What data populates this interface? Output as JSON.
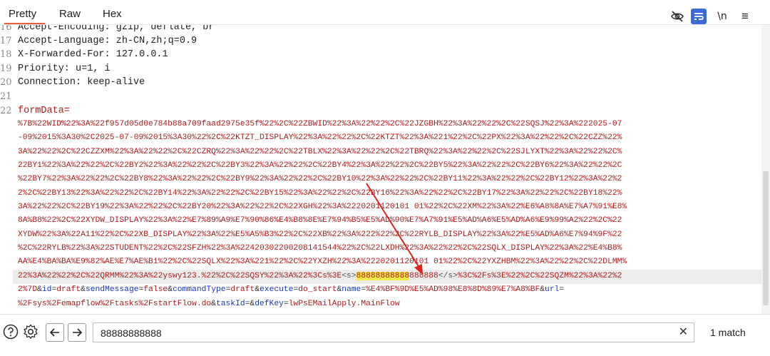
{
  "tabs": [
    "Pretty",
    "Raw",
    "Hex"
  ],
  "toolbar": {
    "newline_label": "\\n",
    "menu_label": "≡"
  },
  "lines": [
    {
      "no": "16",
      "text": "Accept-Encoding: gzip, deflate, br"
    },
    {
      "no": "17",
      "text": "Accept-Language: zh-CN,zh;q=0.9"
    },
    {
      "no": "18",
      "text": "X-Forwarded-For: 127.0.0.1"
    },
    {
      "no": "19",
      "text": "Priority: u=1, i"
    },
    {
      "no": "20",
      "text": "Connection: keep-alive"
    },
    {
      "no": "21",
      "text": ""
    },
    {
      "no": "22",
      "text": "formData="
    }
  ],
  "body_rows": [
    "%7B%22WID%22%3A%22f957d05d0e784b88a709faad2975e35f%22%2C%22ZBWID%22%3A%22%22%2C%22JZGBH%22%3A%22%22%2C%22SQSJ%22%3A%222025-07",
    "-09%2015%3A30%2C2025-07-09%2015%3A30%22%2C%22KTZT_DISPLAY%22%3A%22%22%2C%22KTZT%22%3A%221%22%2C%22PX%22%3A%22%22%2C%22CZZ%22%",
    "3A%22%22%2C%22CZZXM%22%3A%22%22%2C%22CZRQ%22%3A%22%22%2C%22TBLX%22%3A%22%22%2C%22TBRQ%22%3A%22%22%2C%22SJLYXT%22%3A%22%22%2C%",
    "22BY1%22%3A%22%22%2C%22BY2%22%3A%22%22%2C%22BY3%22%3A%22%22%2C%22BY4%22%3A%22%22%2C%22BY5%22%3A%22%22%2C%22BY6%22%3A%22%22%2C",
    "%22BY7%22%3A%22%22%2C%22BY8%22%3A%22%22%2C%22BY9%22%3A%22%22%2C%22BY10%22%3A%22%22%2C%22BY11%22%3A%22%22%2C%22BY12%22%3A%22%2",
    "2%2C%22BY13%22%3A%22%22%2C%22BY14%22%3A%22%22%2C%22BY15%22%3A%22%22%2C%22BY16%22%3A%22%22%2C%22BY17%22%3A%22%22%2C%22BY18%22%",
    "3A%22%22%2C%22BY19%22%3A%22%22%2C%22BY20%22%3A%22%22%2C%22XGH%22%3A%2220201120101 01%22%2C%22XM%22%3A%22%E6%A8%8A%E7%A7%91%E8%",
    "8A%B8%22%2C%22XYDW_DISPLAY%22%3A%22%E7%89%A9%E7%90%86%E4%B8%8E%E7%94%B5%E5%AD%90%E7%A7%91%E5%AD%A6%E5%AD%A6%E9%99%A2%22%2C%22",
    "XYDW%22%3A%22A11%22%2C%22XB_DISPLAY%22%3A%22%E5%A5%B3%22%2C%22XB%22%3A%222%22%2C%22RYLB_DISPLAY%22%3A%22%E5%AD%A6%E7%94%9F%22",
    "%2C%22RYLB%22%3A%22STUDENT%22%2C%22SFZH%22%3A%22420302200208141544%22%2C%22LXDH%22%3A%22%22%2C%22SQLX_DISPLAY%22%3A%22%E4%B8%",
    "AA%E4%BA%BA%E9%82%AE%E7%AE%B1%22%2C%22SQLX%22%3A%221%22%2C%22YXZH%22%3A%2220201120101 01%22%2C%22YXZHBM%22%3A%22%22%2C%22DLMM%"
  ],
  "highlight_row": {
    "before": "22%3A%22%22%2C%22QRMM%22%3A%22yswy123.%22%2C%22SQSY%22%3A%22%3Cs%3E",
    "tag_open": "<s>",
    "match": "88888888888",
    "after_match": "888888",
    "tag_close": "</s>",
    "tail": "%3C%2Fs%3E%22%2C%22SQZM%22%3A%22%2"
  },
  "param_row": [
    {
      "t": "2%7D",
      "c": "v"
    },
    {
      "t": "&",
      "c": "p"
    },
    {
      "t": "id",
      "c": "k"
    },
    {
      "t": "=",
      "c": "p"
    },
    {
      "t": "draft",
      "c": "v"
    },
    {
      "t": "&",
      "c": "p"
    },
    {
      "t": "sendMessage",
      "c": "k"
    },
    {
      "t": "=",
      "c": "p"
    },
    {
      "t": "false",
      "c": "v"
    },
    {
      "t": "&",
      "c": "p"
    },
    {
      "t": "commandType",
      "c": "k"
    },
    {
      "t": "=",
      "c": "p"
    },
    {
      "t": "draft",
      "c": "v"
    },
    {
      "t": "&",
      "c": "p"
    },
    {
      "t": "execute",
      "c": "k"
    },
    {
      "t": "=",
      "c": "p"
    },
    {
      "t": "do_start",
      "c": "v"
    },
    {
      "t": "&",
      "c": "p"
    },
    {
      "t": "name",
      "c": "k"
    },
    {
      "t": "=",
      "c": "p"
    },
    {
      "t": "%E4%BF%9D%E5%AD%98%E8%8D%89%E7%A8%BF",
      "c": "v"
    },
    {
      "t": "&",
      "c": "p"
    },
    {
      "t": "url",
      "c": "k"
    },
    {
      "t": "=",
      "c": "p"
    }
  ],
  "last_row": [
    {
      "t": "%2Fsys%2Femapflow%2Ftasks%2FstartFlow.do",
      "c": "v"
    },
    {
      "t": "&",
      "c": "p"
    },
    {
      "t": "taskId",
      "c": "k"
    },
    {
      "t": "=",
      "c": "p"
    },
    {
      "t": "&",
      "c": "p"
    },
    {
      "t": "defKey",
      "c": "k"
    },
    {
      "t": "=",
      "c": "p"
    },
    {
      "t": "lwPsEMailApply.MainFlow",
      "c": "v"
    }
  ],
  "search": {
    "value": "88888888888",
    "matches": "1 match"
  },
  "colors": {
    "accent": "#e8603c",
    "code_value": "#b21a1a",
    "code_key": "#1a35c8",
    "highlight": "#f5e94a",
    "arrow": "#e0211a",
    "wrap_icon": "#3a6bd6"
  },
  "icons": [
    "eye-slash-icon",
    "wrap-lines-icon",
    "help-icon",
    "gear-icon",
    "arrow-left-icon",
    "arrow-right-icon",
    "clear-icon",
    "hamburger-menu-icon"
  ]
}
